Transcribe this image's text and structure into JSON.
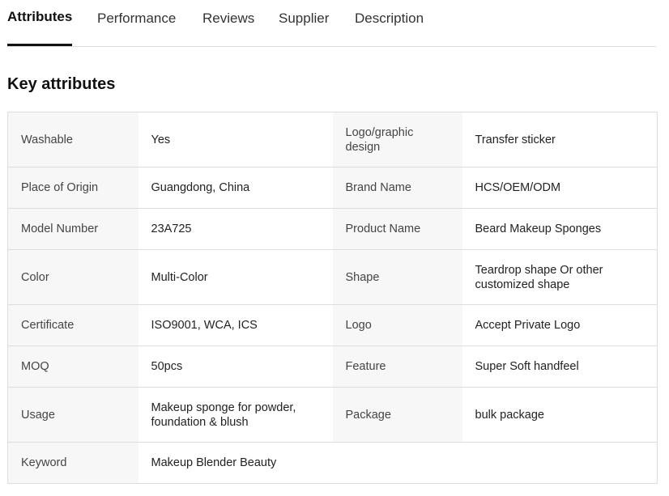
{
  "tabs": [
    {
      "label": "Attributes",
      "active": true
    },
    {
      "label": "Performance",
      "active": false
    },
    {
      "label": "Reviews",
      "active": false
    },
    {
      "label": "Supplier",
      "active": false
    },
    {
      "label": "Description",
      "active": false
    }
  ],
  "section_title": "Key attributes",
  "attributes": {
    "washable": {
      "key": "Washable",
      "value": "Yes"
    },
    "logo_graphic_design": {
      "key": "Logo/graphic design",
      "value": "Transfer sticker"
    },
    "place_of_origin": {
      "key": "Place of Origin",
      "value": "Guangdong, China"
    },
    "brand_name": {
      "key": "Brand Name",
      "value": "HCS/OEM/ODM"
    },
    "model_number": {
      "key": "Model Number",
      "value": "23A725"
    },
    "product_name": {
      "key": "Product Name",
      "value": "Beard Makeup Sponges"
    },
    "color": {
      "key": "Color",
      "value": "Multi-Color"
    },
    "shape": {
      "key": "Shape",
      "value": "Teardrop shape Or other customized shape"
    },
    "certificate": {
      "key": "Certificate",
      "value": "ISO9001, WCA, ICS"
    },
    "logo": {
      "key": "Logo",
      "value": "Accept Private Logo"
    },
    "moq": {
      "key": "MOQ",
      "value": "50pcs"
    },
    "feature": {
      "key": "Feature",
      "value": "Super Soft handfeel"
    },
    "usage": {
      "key": "Usage",
      "value": "Makeup sponge for powder, foundation & blush"
    },
    "package": {
      "key": "Package",
      "value": "bulk package"
    },
    "keyword": {
      "key": "Keyword",
      "value": "Makeup Blender Beauty"
    }
  },
  "colors": {
    "accent": "#111111",
    "key_cell_bg": "#f7f7f7",
    "border": "#dddddd"
  }
}
